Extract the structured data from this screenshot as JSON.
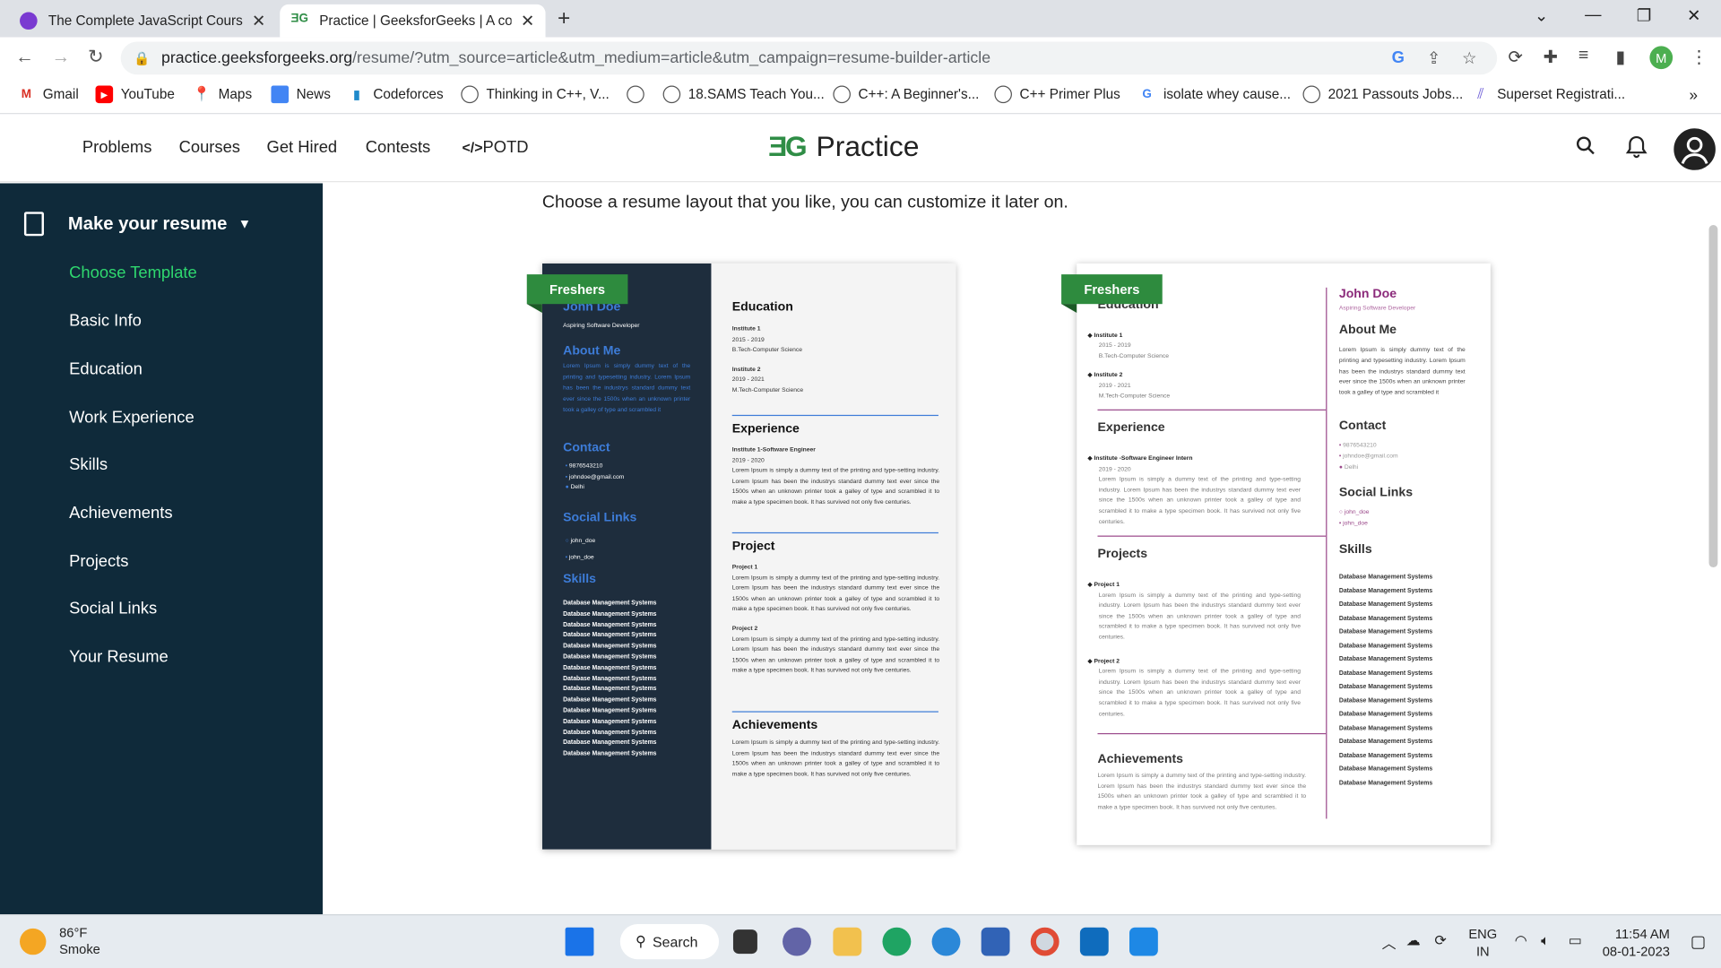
{
  "browser": {
    "tabs": [
      {
        "title": "The Complete JavaScript Course"
      },
      {
        "title": "Practice | GeeksforGeeks | A comp"
      }
    ],
    "url_host": "practice.geeksforgeeks.org",
    "url_path": "/resume/?utm_source=article&utm_medium=article&utm_campaign=resume-builder-article",
    "profile_initial": "M",
    "bookmarks": [
      "Gmail",
      "YouTube",
      "Maps",
      "News",
      "Codeforces",
      "Thinking in C++, V...",
      "18.SAMS Teach You...",
      "C++: A Beginner's...",
      "C++ Primer Plus",
      "isolate whey cause...",
      "2021 Passouts Jobs...",
      "Superset Registrati..."
    ],
    "bookmarks_more": "»"
  },
  "site": {
    "nav": [
      "Problems",
      "Courses",
      "Get Hired",
      "Contests",
      "POTD"
    ],
    "potd_prefix": "</>",
    "logo_mark": "ƎG",
    "logo_text": "Practice"
  },
  "sidebar": {
    "heading": "Make your resume",
    "items": [
      "Choose Template",
      "Basic Info",
      "Education",
      "Work Experience",
      "Skills",
      "Achievements",
      "Projects",
      "Social Links",
      "Your Resume"
    ]
  },
  "main": {
    "intro": "Choose a resume layout that you like, you can customize it later on.",
    "ribbon": "Freshers"
  },
  "resume": {
    "name": "John Doe",
    "role": "Aspiring Software Developer",
    "about_h": "About Me",
    "about": "Lorem Ipsum is simply dummy text of the printing and typesetting industry. Lorem Ipsum has been the industrys standard dummy text ever since the 1500s when an unknown printer took a galley of type and scrambled it",
    "contact_h": "Contact",
    "phone": "9876543210",
    "email": "johndoe@gmail.com",
    "city": "Delhi",
    "social_h": "Social Links",
    "handle": "john_doe",
    "skills_h": "Skills",
    "skill": "Database Management Systems",
    "education_h": "Education",
    "inst1": "Institute 1",
    "yr1": "2015 - 2019",
    "deg1": "B.Tech-Computer Science",
    "inst2": "Institute 2",
    "yr2": "2019 - 2021",
    "deg2": "M.Tech-Computer Science",
    "experience_h": "Experience",
    "exp_title1": "Institute 1-Software Engineer",
    "exp_title2": "Institute -Software Engineer Intern",
    "exp_yr": "2019 - 2020",
    "body": "Lorem Ipsum is simply a dummy text of the printing and type-setting industry. Lorem Ipsum has been the industrys standard dummy text ever since the 1500s when an unknown printer took a galley of type and scrambled it to make a type specimen book. It has survived not only five centuries.",
    "project_h1": "Project",
    "project_h2": "Projects",
    "proj1": "Project 1",
    "proj2": "Project 2",
    "achievements_h": "Achievements"
  },
  "taskbar": {
    "temp": "86°F",
    "weather": "Smoke",
    "search": "Search",
    "lang1": "ENG",
    "lang2": "IN",
    "time": "11:54 AM",
    "date": "08-01-2023"
  },
  "colors": {
    "brand_green": "#2f8d46",
    "sidebar_bg": "#0f2a3a",
    "active_item": "#2fd86f",
    "resume_blue": "#3d7cd8",
    "resume_purple": "#8b2a7a"
  }
}
